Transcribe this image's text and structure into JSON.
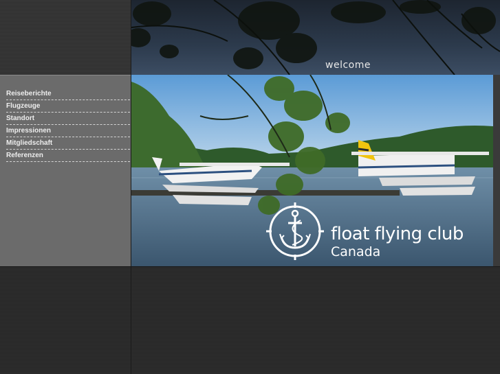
{
  "header": {
    "welcome_text": "welcome"
  },
  "navigation": {
    "items": [
      {
        "label": "Reiseberichte"
      },
      {
        "label": "Flugzeuge"
      },
      {
        "label": "Standort"
      },
      {
        "label": "Impressionen"
      },
      {
        "label": "Mitgliedschaft"
      },
      {
        "label": "Referenzen"
      }
    ]
  },
  "brand": {
    "name": "float flying club",
    "country": "Canada",
    "logo_icon": "anchor-icon"
  },
  "colors": {
    "menu_background": "#6b6b6b",
    "page_background": "#2b2b2b",
    "sky": "#6aa4d8",
    "water": "#4f6f8a",
    "forest": "#2f5a2a"
  }
}
